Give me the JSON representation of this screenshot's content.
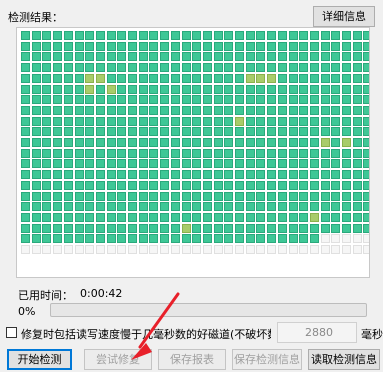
{
  "labels": {
    "result_label": "检测结果：",
    "elapsed_label": "已用时间：",
    "elapsed_value": "0:00:42",
    "progress_percent": "0%",
    "repair_option": "修复时包括读写速度慢于几毫秒数的好磁道(不破坏数据)：",
    "threshold_value": "2880",
    "unit": "毫秒"
  },
  "buttons": {
    "details": "详细信息",
    "start": "开始检测",
    "try_repair": "尝试修复",
    "save_report": "保存报表",
    "save_info": "保存检测信息",
    "read_info": "读取检测信息"
  },
  "progress": {
    "fraction": 0
  },
  "checkbox": {
    "checked": false
  },
  "grid": {
    "cols": 33,
    "rows": 21,
    "filled_cells": 655,
    "slow_cells": [
      [
        4,
        6
      ],
      [
        4,
        7
      ],
      [
        5,
        6
      ],
      [
        5,
        8
      ],
      [
        4,
        21
      ],
      [
        4,
        22
      ],
      [
        4,
        23
      ],
      [
        8,
        20
      ],
      [
        10,
        28
      ],
      [
        10,
        30
      ],
      [
        17,
        27
      ],
      [
        18,
        15
      ]
    ],
    "colors": {
      "ok": "#3ec796",
      "slow": "#a8cc6a",
      "empty": "#f6f6f6"
    }
  },
  "annotation": {
    "color": "#e8202a"
  }
}
